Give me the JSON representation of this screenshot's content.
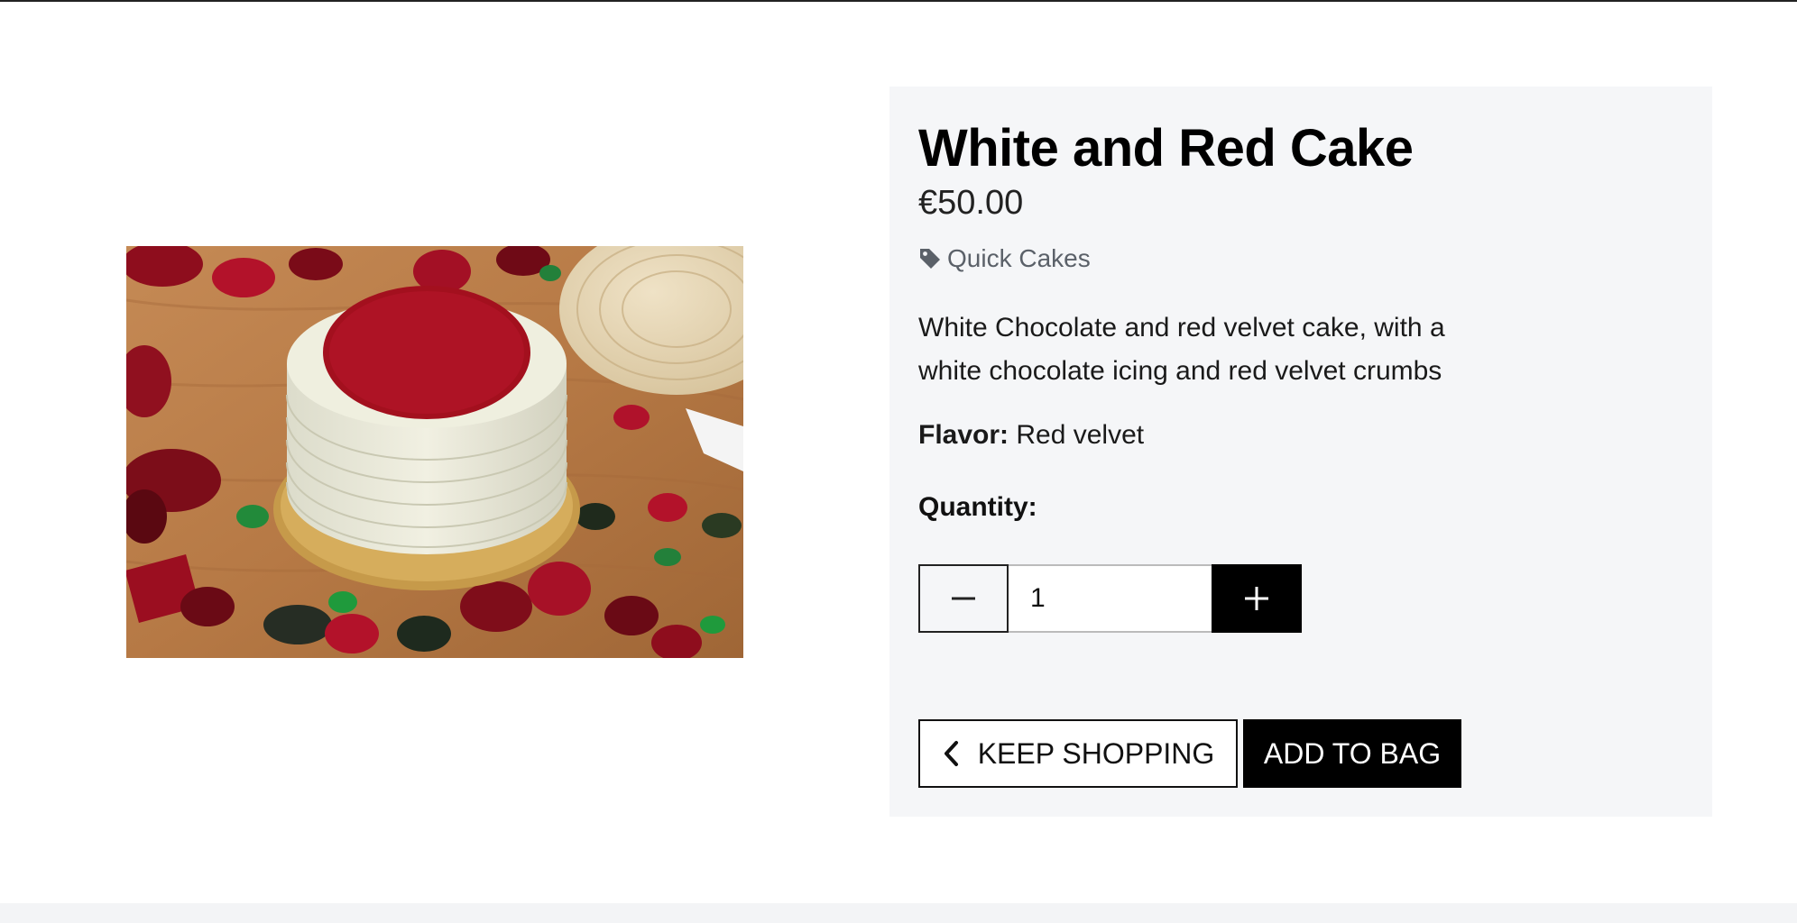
{
  "product": {
    "title": "White and Red Cake",
    "price": "€50.00",
    "category": "Quick Cakes",
    "category_icon": "tag-icon",
    "description": "White Chocolate and red velvet cake, with a white chocolate icing and red velvet crumbs",
    "flavor_label": "Flavor:",
    "flavor_value": "Red velvet"
  },
  "quantity": {
    "label": "Quantity:",
    "value": "1",
    "decrement_symbol": "−",
    "increment_symbol": "+"
  },
  "actions": {
    "keep_shopping_label": "KEEP SHOPPING",
    "keep_shopping_icon": "chevron-left-icon",
    "add_to_bag_label": "ADD TO BAG"
  },
  "colors": {
    "panel_background": "#f5f6f8",
    "primary_button": "#000000",
    "category_text": "#5b6169"
  }
}
